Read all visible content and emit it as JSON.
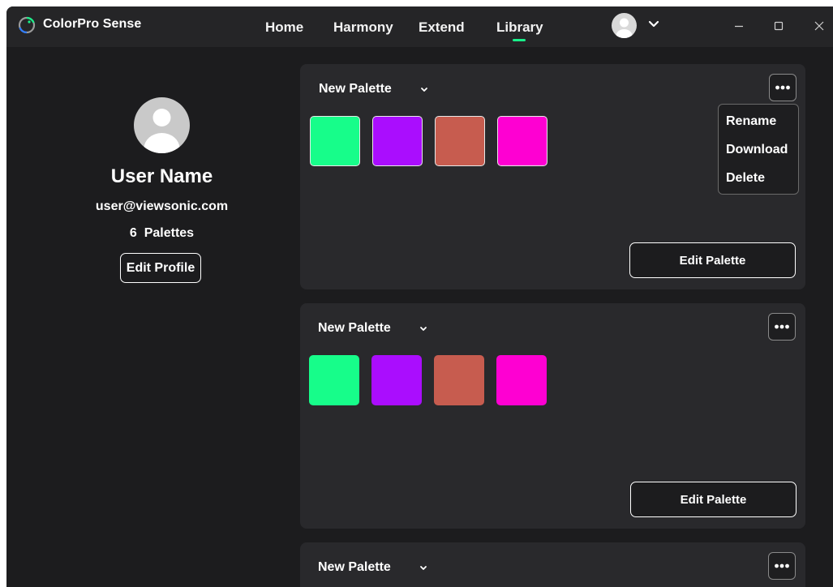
{
  "app": {
    "title": "ColorPro Sense"
  },
  "nav": {
    "items": [
      "Home",
      "Harmony",
      "Extend",
      "Library"
    ],
    "active": "Library"
  },
  "window_controls": [
    "minimize-icon",
    "maximize-icon",
    "close-icon"
  ],
  "profile": {
    "name": "User Name",
    "email": "user@viewsonic.com",
    "palette_count": "6",
    "palettes_label": "Palettes",
    "edit_label": "Edit Profile"
  },
  "palettes": [
    {
      "name": "New Palette",
      "colors": [
        "#17fd8a",
        "#aa0dfe",
        "#c75c4f",
        "#fe00d2"
      ],
      "edit_label": "Edit Palette"
    },
    {
      "name": "New Palette",
      "colors": [
        "#17fd8a",
        "#aa0dfe",
        "#c75c4f",
        "#fe00d2"
      ],
      "edit_label": "Edit Palette"
    },
    {
      "name": "New Palette"
    }
  ],
  "context_menu": {
    "items": [
      "Rename",
      "Download",
      "Delete"
    ]
  },
  "colors": {
    "accent": "#19f08a",
    "background": "#1c1c1e",
    "card": "#29292c"
  }
}
